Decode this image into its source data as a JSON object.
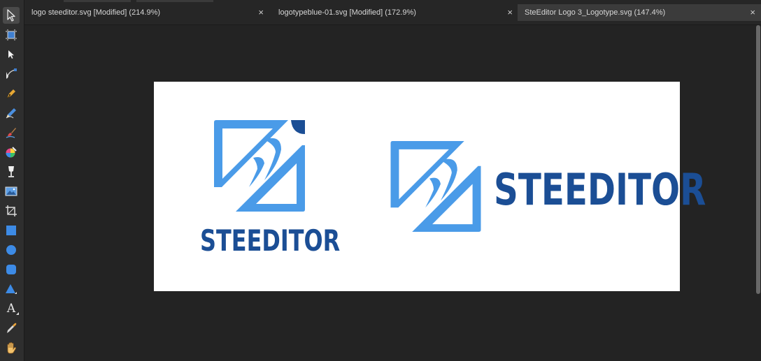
{
  "tabs": [
    {
      "title": "logo steeditor.svg [Modified] (214.9%)",
      "close": "×",
      "active": false
    },
    {
      "title": "logotypeblue-01.svg [Modified] (172.9%)",
      "close": "×",
      "active": false
    },
    {
      "title": "SteEditor Logo 3_Logotype.svg (147.4%)",
      "close": "×",
      "active": true
    }
  ],
  "tools": [
    {
      "name": "move-tool-icon"
    },
    {
      "name": "artboard-tool-icon"
    },
    {
      "name": "node-tool-icon"
    },
    {
      "name": "corner-tool-icon"
    },
    {
      "name": "pen-tool-icon"
    },
    {
      "name": "pencil-tool-icon"
    },
    {
      "name": "vector-brush-tool-icon"
    },
    {
      "name": "fill-tool-icon"
    },
    {
      "name": "transparency-tool-icon"
    },
    {
      "name": "place-image-tool-icon"
    },
    {
      "name": "crop-tool-icon"
    },
    {
      "name": "rectangle-tool-icon"
    },
    {
      "name": "ellipse-tool-icon"
    },
    {
      "name": "rounded-rectangle-tool-icon"
    },
    {
      "name": "triangle-tool-icon"
    },
    {
      "name": "text-tool-icon",
      "glyph": "A"
    },
    {
      "name": "color-picker-tool-icon"
    },
    {
      "name": "view-tool-icon"
    }
  ],
  "canvas": {
    "logo_stacked_text": "STEEDITOR",
    "logo_horizontal_text": "STEEDITOR",
    "colors": {
      "light_blue": "#4a9be8",
      "dark_blue": "#1b4e95",
      "artboard": "#ffffff",
      "background": "#232323"
    }
  }
}
